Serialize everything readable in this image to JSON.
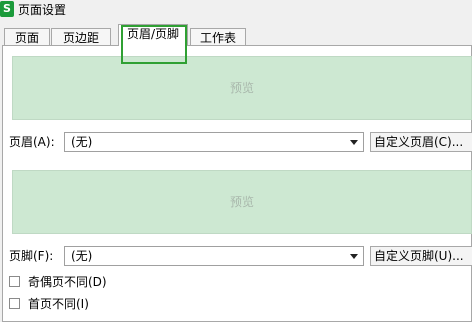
{
  "window": {
    "title": "页面设置",
    "app_icon_letter": "S"
  },
  "tabs": [
    {
      "label": "页面",
      "active": false
    },
    {
      "label": "页边距",
      "active": false
    },
    {
      "label": "页眉/页脚",
      "active": true
    },
    {
      "label": "工作表",
      "active": false
    }
  ],
  "header_section": {
    "preview_text": "预览",
    "label": "页眉(A):",
    "select_value": "(无)",
    "custom_button": "自定义页眉(C)..."
  },
  "footer_section": {
    "preview_text": "预览",
    "label": "页脚(F):",
    "select_value": "(无)",
    "custom_button": "自定义页脚(U)..."
  },
  "options": [
    {
      "label": "奇偶页不同(D)",
      "checked": false
    },
    {
      "label": "首页不同(I)",
      "checked": false
    }
  ],
  "colors": {
    "preview_bg": "#cde8d2",
    "highlight_border": "#2fa033",
    "app_icon": "#1a9a3a"
  }
}
